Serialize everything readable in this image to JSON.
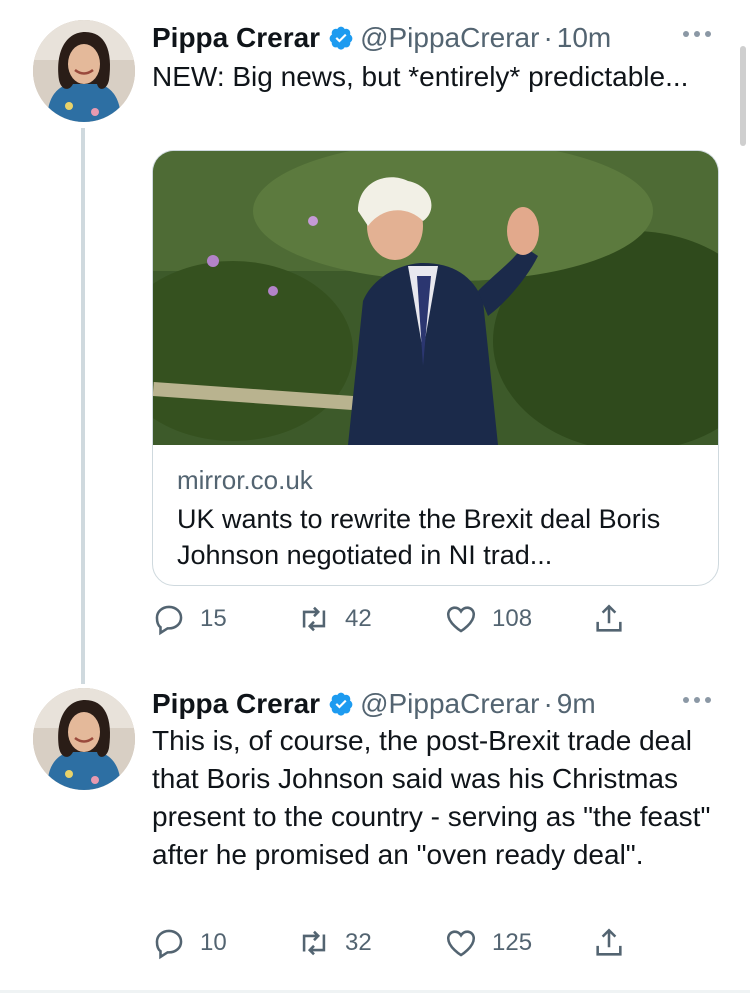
{
  "tweets": [
    {
      "name": "Pippa Crerar",
      "handle": "@PippaCrerar",
      "time": "10m",
      "text": "NEW: Big news, but *entirely* predictable...",
      "card": {
        "domain": "mirror.co.uk",
        "title": "UK wants to rewrite the Brexit deal Boris Johnson negotiated in NI trad..."
      },
      "replies": "15",
      "retweets": "42",
      "likes": "108"
    },
    {
      "name": "Pippa Crerar",
      "handle": "@PippaCrerar",
      "time": "9m",
      "text": "This is, of course, the post-Brexit trade deal that Boris Johnson said was his Christmas present to the country - serving as \"the feast\" after he promised an \"oven ready deal\".",
      "replies": "10",
      "retweets": "32",
      "likes": "125"
    }
  ],
  "icons": {
    "verified": "verified-badge-icon",
    "more": "more-icon",
    "reply": "reply-icon",
    "retweet": "retweet-icon",
    "like": "heart-icon",
    "share": "share-icon"
  },
  "colors": {
    "verified": "#1d9bf0",
    "secondary_text": "#536471",
    "thread_line": "#cfd9de"
  }
}
